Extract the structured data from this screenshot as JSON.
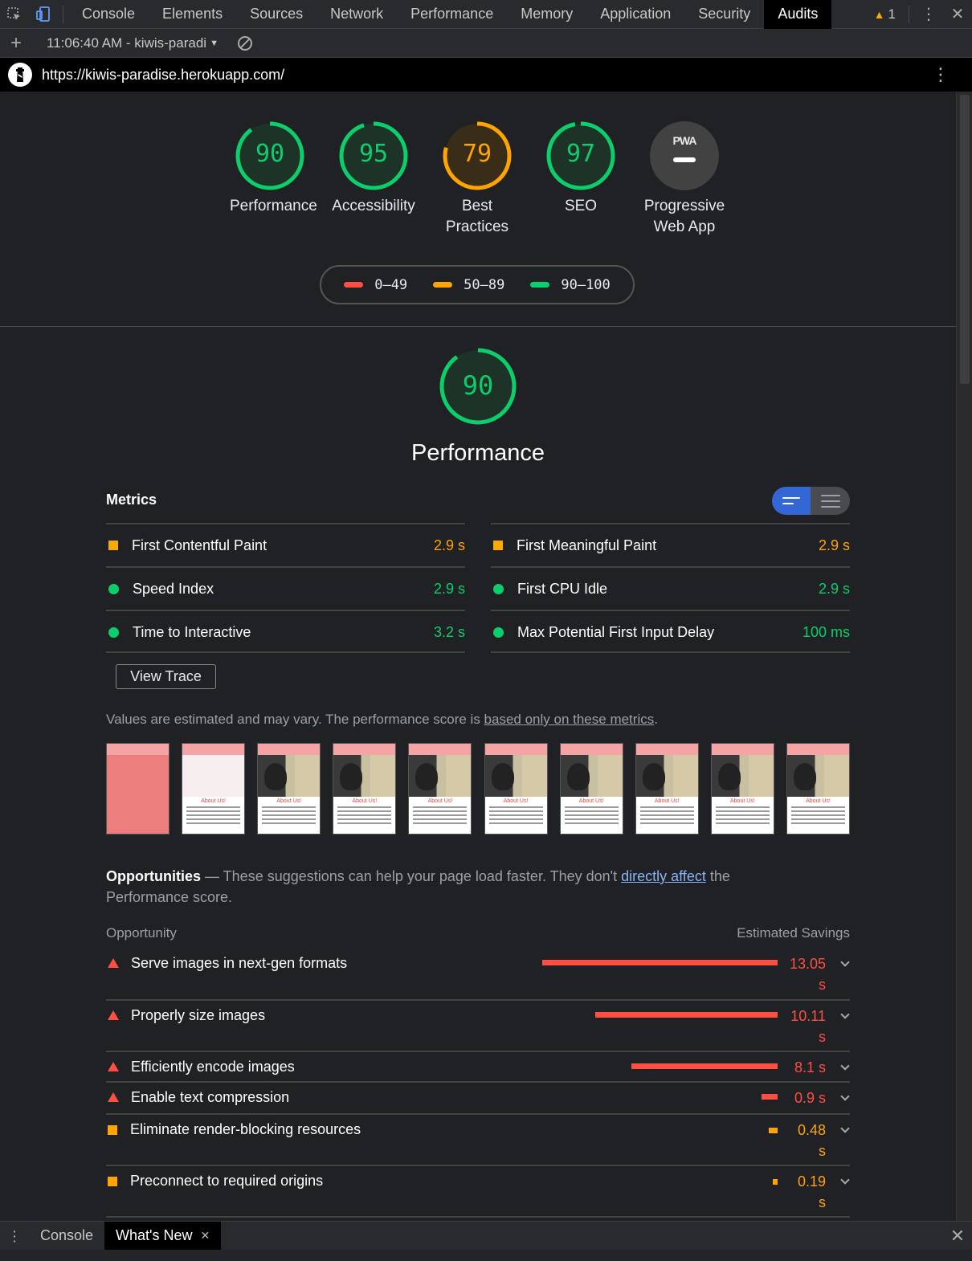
{
  "devtools": {
    "tabs": [
      "Console",
      "Elements",
      "Sources",
      "Network",
      "Performance",
      "Memory",
      "Application",
      "Security",
      "Audits"
    ],
    "active_tab": "Audits",
    "warning_count": "1"
  },
  "toolbar": {
    "report_label": "11:06:40 AM - kiwis-paradi"
  },
  "report": {
    "url": "https://kiwis-paradise.herokuapp.com/"
  },
  "scores": [
    {
      "label": "Performance",
      "value": "90",
      "score": 90,
      "color": "#0cce6b"
    },
    {
      "label": "Accessibility",
      "value": "95",
      "score": 95,
      "color": "#0cce6b"
    },
    {
      "label": "Best Practices",
      "value": "79",
      "score": 79,
      "color": "#ffa400"
    },
    {
      "label": "SEO",
      "value": "97",
      "score": 97,
      "color": "#0cce6b"
    },
    {
      "label": "Progressive Web App",
      "value": "PWA"
    }
  ],
  "legend": {
    "fail": {
      "label": "0–49",
      "color": "#ff4e42"
    },
    "average": {
      "label": "50–89",
      "color": "#ffa400"
    },
    "pass": {
      "label": "90–100",
      "color": "#0cce6b"
    }
  },
  "performance": {
    "score": "90",
    "title": "Performance",
    "metrics_title": "Metrics",
    "metrics": [
      {
        "name": "First Contentful Paint",
        "value": "2.9 s",
        "status": "average"
      },
      {
        "name": "First Meaningful Paint",
        "value": "2.9 s",
        "status": "average"
      },
      {
        "name": "Speed Index",
        "value": "2.9 s",
        "status": "pass"
      },
      {
        "name": "First CPU Idle",
        "value": "2.9 s",
        "status": "pass"
      },
      {
        "name": "Time to Interactive",
        "value": "3.2 s",
        "status": "pass"
      },
      {
        "name": "Max Potential First Input Delay",
        "value": "100 ms",
        "status": "pass"
      }
    ],
    "view_trace_label": "View Trace",
    "note_text": "Values are estimated and may vary. The performance score is ",
    "note_link": "based only on these metrics",
    "note_end": "."
  },
  "opportunities": {
    "title": "Opportunities",
    "desc_before": " — These suggestions can help your page load faster. They don't ",
    "desc_link": "directly affect",
    "desc_after": " the Performance score.",
    "col_opportunity": "Opportunity",
    "col_savings": "Estimated Savings",
    "items": [
      {
        "name": "Serve images in next-gen formats",
        "value": "13.05",
        "unit": "s",
        "savings_s": 13.05,
        "status": "fail"
      },
      {
        "name": "Properly size images",
        "value": "10.11",
        "unit": "s",
        "savings_s": 10.11,
        "status": "fail"
      },
      {
        "name": "Efficiently encode images",
        "value": "8.1 s",
        "savings_s": 8.1,
        "status": "fail"
      },
      {
        "name": "Enable text compression",
        "value": "0.9 s",
        "savings_s": 0.9,
        "status": "fail"
      },
      {
        "name": "Eliminate render-blocking resources",
        "value": "0.48",
        "unit": "s",
        "savings_s": 0.48,
        "status": "average"
      },
      {
        "name": "Preconnect to required origins",
        "value": "0.19",
        "unit": "s",
        "savings_s": 0.19,
        "status": "average"
      }
    ]
  },
  "filmstrip": {
    "frame_heading": "About Us!"
  },
  "drawer": {
    "tabs": [
      "Console",
      "What's New"
    ],
    "active_tab": "What's New"
  }
}
